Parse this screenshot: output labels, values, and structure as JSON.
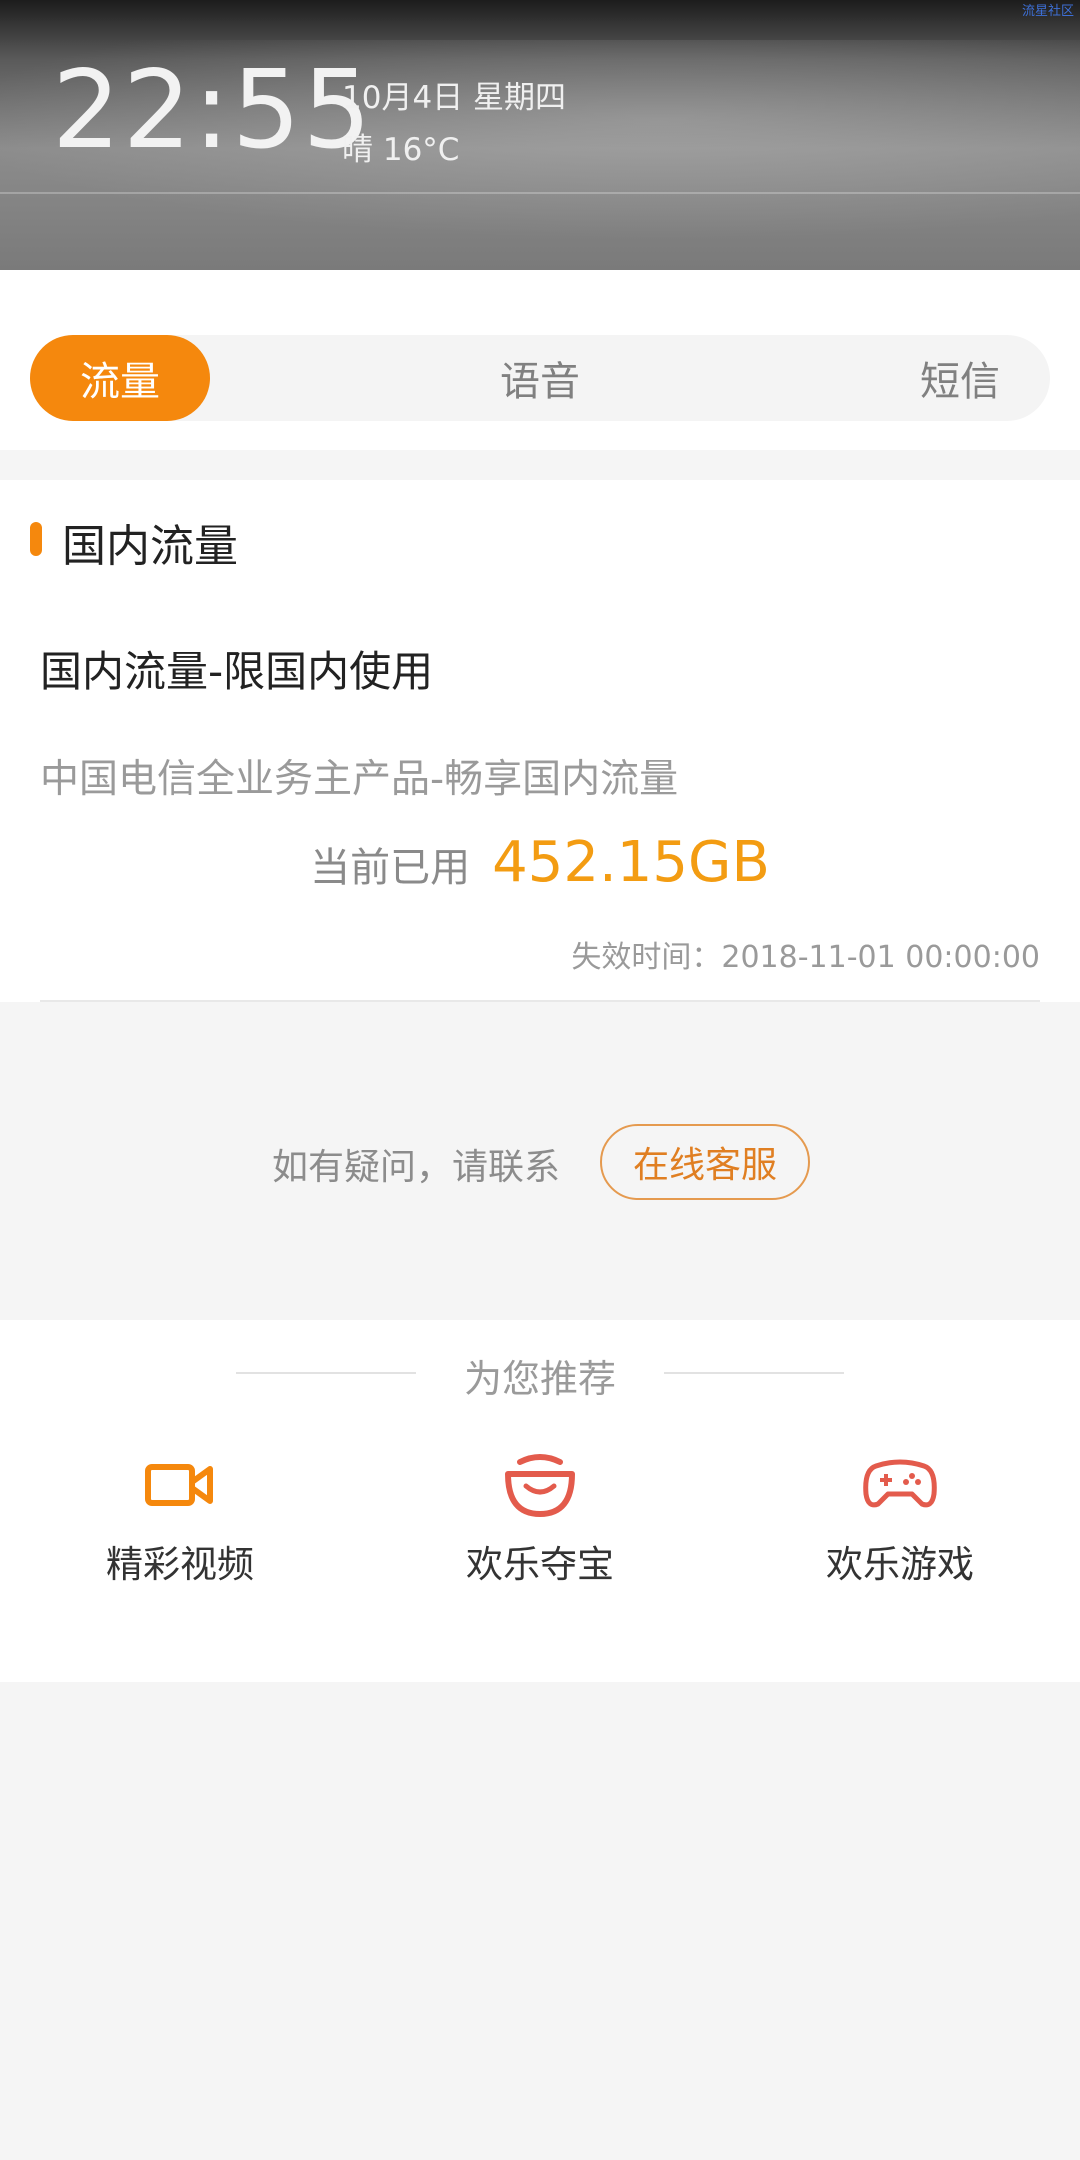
{
  "status": {
    "time": "22:55",
    "date": "10月4日 星期四",
    "weather": "晴 16°C",
    "watermark": "流星社区"
  },
  "tabs": [
    {
      "label": "流量",
      "active": true
    },
    {
      "label": "语音",
      "active": false
    },
    {
      "label": "短信",
      "active": false
    }
  ],
  "card": {
    "section_title": "国内流量",
    "package_name": "国内流量-限国内使用",
    "package_desc": "中国电信全业务主产品-畅享国内流量",
    "usage_label": "当前已用",
    "usage_value": "452.15GB",
    "expire": "失效时间：2018-11-01 00:00:00"
  },
  "contact": {
    "text": "如有疑问，请联系",
    "button": "在线客服"
  },
  "recommend": {
    "title": "为您推荐",
    "items": [
      {
        "label": "精彩视频",
        "icon": "video-camera-icon"
      },
      {
        "label": "欢乐夺宝",
        "icon": "treasure-bowl-icon"
      },
      {
        "label": "欢乐游戏",
        "icon": "gamepad-icon"
      }
    ]
  },
  "colors": {
    "accent": "#f5880d",
    "usage_value": "#f39c12",
    "icon_orange": "#f5880d",
    "icon_red": "#e35b4c"
  }
}
